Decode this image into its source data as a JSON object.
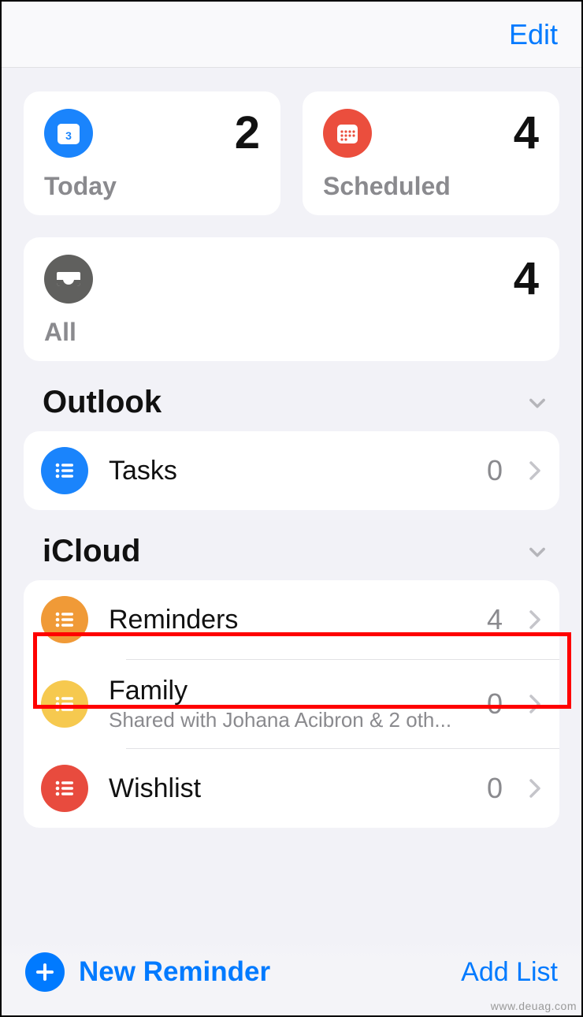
{
  "header": {
    "edit_label": "Edit"
  },
  "smart": {
    "today": {
      "label": "Today",
      "count": "2",
      "color": "#1a84fc"
    },
    "scheduled": {
      "label": "Scheduled",
      "count": "4",
      "color": "#eb4e3d"
    },
    "all": {
      "label": "All",
      "count": "4",
      "color": "#60605e"
    }
  },
  "sections": [
    {
      "title": "Outlook",
      "lists": [
        {
          "name": "Tasks",
          "count": "0",
          "color": "#1a84fc"
        }
      ]
    },
    {
      "title": "iCloud",
      "lists": [
        {
          "name": "Reminders",
          "count": "4",
          "color": "#f09a37",
          "highlighted": true
        },
        {
          "name": "Family",
          "count": "0",
          "color": "#f6c94f",
          "subtitle": "Shared with Johana Acibron & 2 oth..."
        },
        {
          "name": "Wishlist",
          "count": "0",
          "color": "#e84b3e"
        }
      ]
    }
  ],
  "toolbar": {
    "new_reminder_label": "New Reminder",
    "add_list_label": "Add List"
  },
  "watermark": "www.deuag.com"
}
